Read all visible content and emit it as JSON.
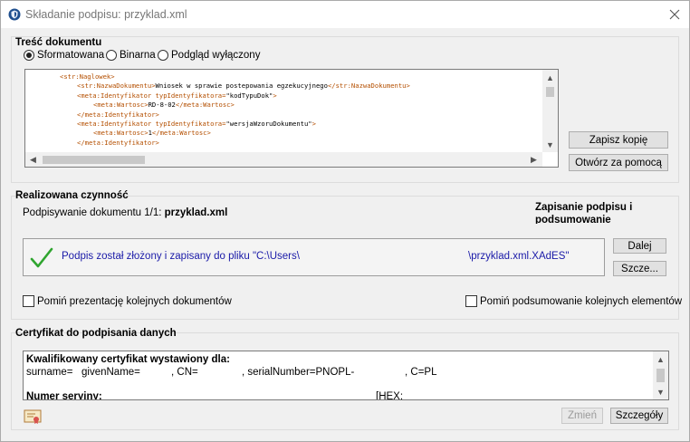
{
  "window": {
    "title": "Składanie podpisu: przyklad.xml"
  },
  "content_group": {
    "title": "Treść dokumentu",
    "radios": [
      {
        "label": "Sformatowana",
        "checked": true
      },
      {
        "label": "Binarna",
        "checked": false
      },
      {
        "label": "Podgląd wyłączony",
        "checked": false
      }
    ],
    "xml_lines": [
      {
        "tag1": "<str:Naglowek>",
        "text": "",
        "tag2": ""
      },
      {
        "tag1": "<str:NazwaDokumentu>",
        "text": "Wniosek w sprawie postepowania egzekucyjnego",
        "tag2": "</str:NazwaDokumentu>"
      },
      {
        "tag1": "<meta:Identyfikator typIdentyfikatora=",
        "text": "\"kodTypuDok\"",
        "tag2": ">"
      },
      {
        "tag1": "<meta:Wartosc>",
        "text": "RD-8-02",
        "tag2": "</meta:Wartosc>"
      },
      {
        "tag1": "</meta:Identyfikator>",
        "text": "",
        "tag2": ""
      },
      {
        "tag1": "<meta:Identyfikator typIdentyfikatora=",
        "text": "\"wersjaWzoruDokumentu\"",
        "tag2": ">"
      },
      {
        "tag1": "<meta:Wartosc>",
        "text": "1",
        "tag2": "</meta:Wartosc>"
      },
      {
        "tag1": "</meta:Identyfikator>",
        "text": "",
        "tag2": ""
      }
    ],
    "save_copy_label": "Zapisz kopię",
    "open_with_label": "Otwórz za pomocą"
  },
  "action_group": {
    "title": "Realizowana czynność",
    "progress_prefix": "Podpisywanie dokumentu 1/1: ",
    "progress_file": "przyklad.xml",
    "stage_label": "Zapisanie podpisu i podsumowanie",
    "result_message": "Podpis został złożony i zapisany do pliku \"C:\\Users\\",
    "result_path_end": "\\przyklad.xml.XAdES\"",
    "next_label": "Dalej",
    "details_label": "Szcze..."
  },
  "options": {
    "skip_presentation_label": "Pomiń prezentację kolejnych dokumentów",
    "skip_summary_label": "Pomiń podsumowanie kolejnych elementów"
  },
  "cert_group": {
    "title": "Certyfikat do podpisania danych",
    "heading": "Kwalifikowany certyfikat wystawiony dla:",
    "surname_label": "surname=",
    "given_label": "givenName=",
    "cn_label": ", CN=",
    "serial_label": ", serialNumber=PNOPL-",
    "country_label": ", C=PL",
    "serial_heading": "Numer seryjny:",
    "hex_label": "[HEX:",
    "change_label": "Zmień",
    "details_label": "Szczegóły"
  },
  "colors": {
    "accent_green": "#2fa52f",
    "message_blue": "#1a1aa8",
    "xml_tag": "#b44f00"
  }
}
